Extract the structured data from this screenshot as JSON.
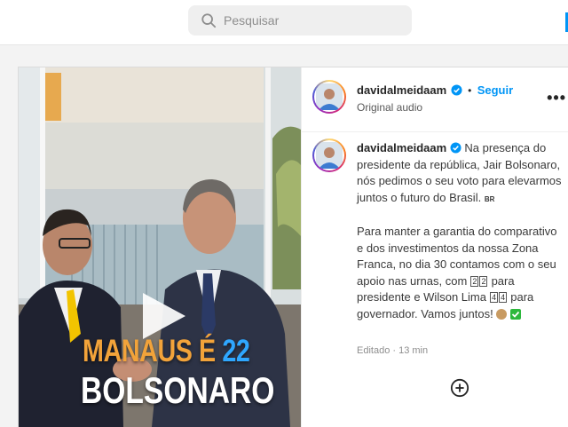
{
  "search": {
    "placeholder": "Pesquisar"
  },
  "post": {
    "media": {
      "overlay_line1_main": "MANAUS É",
      "overlay_line1_number": "22",
      "overlay_line2": "BOLSONARO"
    },
    "header": {
      "username": "davidalmeidaam",
      "dot": "•",
      "follow_label": "Seguir",
      "audio_label": "Original audio",
      "more_label": "•••"
    },
    "caption": {
      "username": "davidalmeidaam",
      "p1_text": "Na presença do presidente da república, Jair Bolsonaro, nós pedimos o seu voto para elevarmos juntos o futuro do Brasil.",
      "p1_flag": "BR",
      "p2_a": "Para manter a garantia do comparativo e dos investimentos da nossa Zona Franca, no dia 30 contamos com o seu apoio nas urnas, com",
      "p2_k1a": "2",
      "p2_k1b": "2",
      "p2_b": "para presidente e Wilson Lima",
      "p2_k2a": "4",
      "p2_k2b": "4",
      "p2_c": "para governador. Vamos juntos!",
      "meta": "Editado · 13 min"
    },
    "colors": {
      "follow": "#0095f6",
      "verified": "#0095f6",
      "overlay_orange": "#f2a33a",
      "overlay_blue": "#2fa7ff"
    }
  }
}
